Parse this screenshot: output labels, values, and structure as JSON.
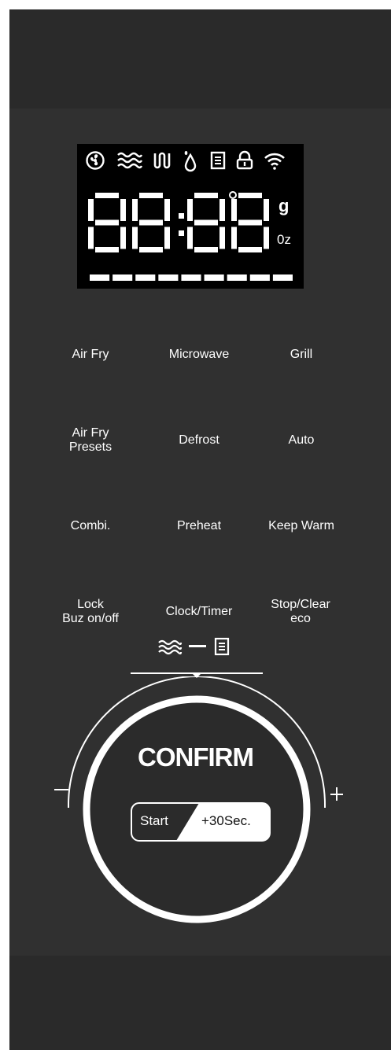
{
  "display": {
    "icons": [
      "fan-icon",
      "microwave-waves-icon",
      "grill-icon",
      "defrost-icon",
      "menu-icon",
      "lock-icon",
      "wifi-icon"
    ],
    "digits": "88:88",
    "unit_g": "g",
    "unit_oz": "0z",
    "dash_count": 9
  },
  "buttons": {
    "air_fry": "Air Fry",
    "microwave": "Microwave",
    "grill": "Grill",
    "air_fry_presets_1": "Air Fry",
    "air_fry_presets_2": "Presets",
    "defrost": "Defrost",
    "auto": "Auto",
    "combi": "Combi.",
    "preheat": "Preheat",
    "keep_warm": "Keep Warm",
    "lock_1": "Lock",
    "lock_2": "Buz on/off",
    "clock_timer": "Clock/Timer",
    "stop_1": "Stop/Clear",
    "stop_2": "eco"
  },
  "dial": {
    "mode_icons": [
      "microwave-waves-icon",
      "dash-icon",
      "menu-icon"
    ],
    "confirm": "CONFIRM",
    "start": "Start",
    "plus_30": "+30Sec."
  },
  "colors": {
    "panel": "#303030",
    "display": "#000000",
    "text": "#ffffff"
  }
}
